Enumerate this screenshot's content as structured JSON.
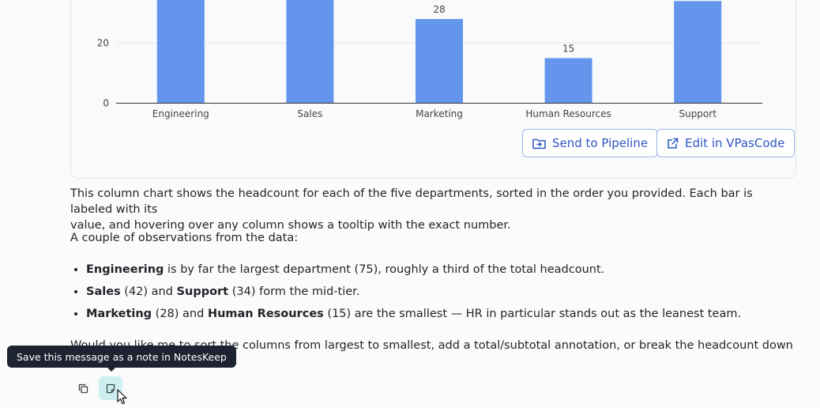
{
  "chart_data": {
    "type": "bar",
    "categories": [
      "Engineering",
      "Sales",
      "Marketing",
      "Human Resources",
      "Support"
    ],
    "values": [
      75,
      42,
      28,
      15,
      34
    ],
    "data_labels": [
      "",
      "",
      "28",
      "15",
      ""
    ],
    "y_ticks": [
      0,
      20
    ],
    "ylim": [
      0,
      80
    ],
    "grid": true,
    "bar_color": "#6495ed"
  },
  "actions": {
    "send_to_pipeline": "Send to Pipeline",
    "edit_in_vpascode": "Edit in VPasCode"
  },
  "message": {
    "paragraph1_line1": "This column chart shows the headcount for each of the five departments, sorted in the order you provided. Each bar is labeled with its",
    "paragraph1_line2": "value, and hovering over any column shows a tooltip with the exact number.",
    "paragraph2": "A couple of observations from the data:",
    "bullets": [
      {
        "b1": "Engineering",
        "t1": " is by far the largest department (75), roughly a third of the total headcount."
      },
      {
        "b1": "Sales",
        "t1": " (42) and ",
        "b2": "Support",
        "t2": " (34) form the mid-tier."
      },
      {
        "b1": "Marketing",
        "t1": " (28) and ",
        "b2": "Human Resources",
        "t2": " (15) are the smallest — HR in particular stands out as the leanest team."
      }
    ],
    "paragraph3_line1": "Would you like me to sort the columns from largest to smallest, add a total/subtotal annotation, or break the headcount down further (e.g.,"
  },
  "tooltip": {
    "text": "Save this message as a note in NotesKeep"
  },
  "colors": {
    "accent": "#2d56c4",
    "tooltip_bg": "#1d2330",
    "active_button_bg": "#cdeff0"
  }
}
